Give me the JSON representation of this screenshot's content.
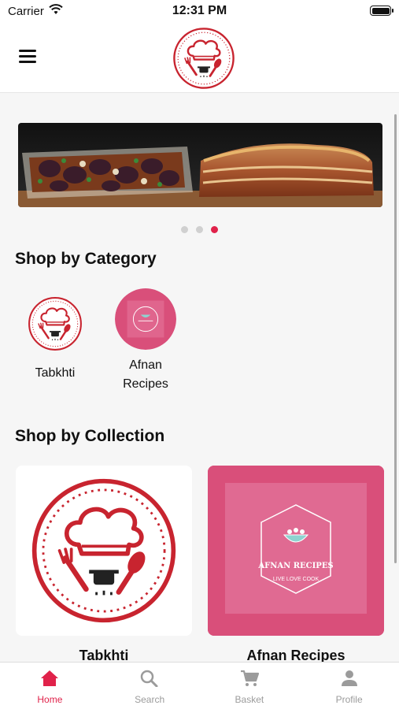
{
  "status": {
    "carrier": "Carrier",
    "time": "12:31 PM"
  },
  "navbar": {
    "menu_icon": "hamburger-menu-icon",
    "logo": "tabkhti-chef-logo"
  },
  "banner": {
    "slide_count": 3,
    "active_slide": 3
  },
  "categories": {
    "title": "Shop by Category",
    "items": [
      {
        "label": "Tabkhti"
      },
      {
        "label": "Afnan Recipes"
      }
    ]
  },
  "collections": {
    "title": "Shop by Collection",
    "items": [
      {
        "label": "Tabkhti"
      },
      {
        "label": "Afnan Recipes",
        "logo_title": "AFNAN RECIPES",
        "logo_tagline": "LIVE LOVE COOK"
      }
    ]
  },
  "tabbar": {
    "items": [
      {
        "label": "Home",
        "icon": "home-icon",
        "active": true
      },
      {
        "label": "Search",
        "icon": "search-icon",
        "active": false
      },
      {
        "label": "Basket",
        "icon": "cart-icon",
        "active": false
      },
      {
        "label": "Profile",
        "icon": "person-icon",
        "active": false
      }
    ]
  },
  "colors": {
    "accent": "#e0224a",
    "brand_red": "#c8242f",
    "brand_pink": "#d94f7a"
  }
}
